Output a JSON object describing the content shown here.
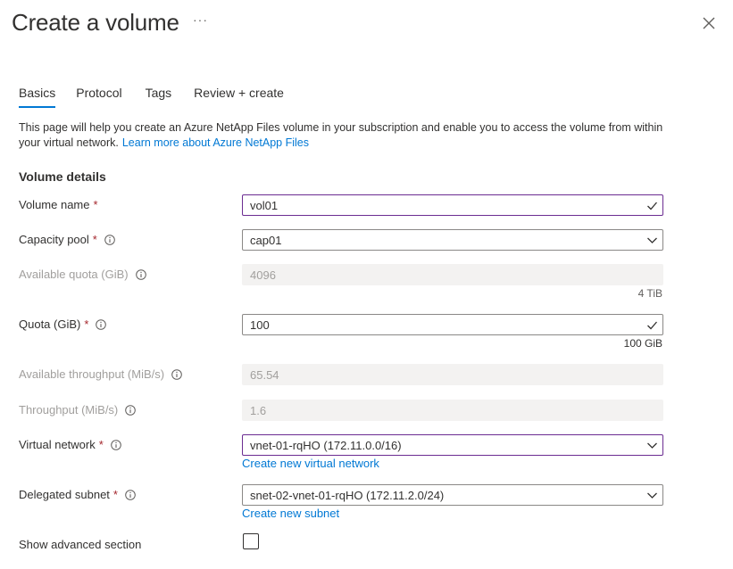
{
  "header": {
    "title": "Create a volume",
    "more": "···"
  },
  "tabs": [
    {
      "label": "Basics",
      "active": true
    },
    {
      "label": "Protocol",
      "active": false
    },
    {
      "label": "Tags",
      "active": false
    },
    {
      "label": "Review + create",
      "active": false
    }
  ],
  "intro": {
    "text": "This page will help you create an Azure NetApp Files volume in your subscription and enable you to access the volume from within your virtual network.",
    "link": "Learn more about Azure NetApp Files"
  },
  "section": {
    "title": "Volume details"
  },
  "fields": {
    "volume_name": {
      "label": "Volume name",
      "required": "*",
      "value": "vol01"
    },
    "capacity_pool": {
      "label": "Capacity pool",
      "required": "*",
      "value": "cap01"
    },
    "available_quota": {
      "label": "Available quota (GiB)",
      "value": "4096",
      "hint": "4 TiB"
    },
    "quota": {
      "label": "Quota (GiB)",
      "required": "*",
      "value": "100",
      "hint": "100 GiB"
    },
    "available_throughput": {
      "label": "Available throughput (MiB/s)",
      "value": "65.54"
    },
    "throughput": {
      "label": "Throughput (MiB/s)",
      "value": "1.6"
    },
    "virtual_network": {
      "label": "Virtual network",
      "required": "*",
      "value": "vnet-01-rqHO (172.11.0.0/16)",
      "link": "Create new virtual network"
    },
    "delegated_subnet": {
      "label": "Delegated subnet",
      "required": "*",
      "value": "snet-02-vnet-01-rqHO (172.11.2.0/24)",
      "link": "Create new subnet"
    },
    "show_advanced": {
      "label": "Show advanced section",
      "checked": false
    }
  },
  "colors": {
    "accent": "#0078d4",
    "focus_border": "#6b2c91",
    "required": "#a4262c"
  }
}
